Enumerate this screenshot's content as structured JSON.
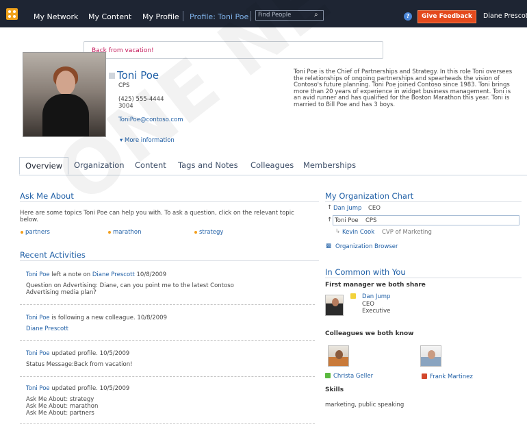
{
  "topbar": {
    "nav": [
      "My Network",
      "My Content",
      "My Profile"
    ],
    "profile_link": "Profile: Toni Poe",
    "search_placeholder": "Find People",
    "help": "?",
    "feedback": "Give Feedback",
    "user": "Diane Prescott"
  },
  "profile": {
    "status": "Back from vacation!",
    "name": "Toni Poe",
    "dept": "CPS",
    "phone": "(425) 555-4444",
    "office": "3004",
    "email": "ToniPoe@contoso.com",
    "more": "More information",
    "bio": "Toni Poe is the Chief of Partnerships and Strategy. In this role Toni oversees the relationships of ongoing partnerships and spearheads the vision of Contoso's future planning. Toni Poe joined Contoso since 1983. Toni brings more than 20 years of experience in widget business management. Toni is an avid runner and has qualified for the Boston Marathon this year. Toni is married to Bill Poe and has 3 boys."
  },
  "tabs": [
    "Overview",
    "Organization",
    "Content",
    "Tags and Notes",
    "Colleagues",
    "Memberships"
  ],
  "ask": {
    "title": "Ask Me About",
    "intro_line1": "Here are some topics Toni Poe can help you with. To ask a question, click on the relevant topic",
    "intro_line2": "below.",
    "topics": [
      "partners",
      "marathon",
      "strategy"
    ]
  },
  "activities": {
    "title": "Recent Activities",
    "items": [
      {
        "actor": "Toni Poe",
        "action": "left a note on",
        "target": "Diane Prescott",
        "date": "10/8/2009",
        "detail1": "Question on Advertising: Diane, can you point me to the latest Contoso",
        "detail2": "Advertising media plan?"
      },
      {
        "actor": "Toni Poe",
        "action": "is following a new colleague.",
        "date": "10/8/2009",
        "link": "Diane Prescott"
      },
      {
        "actor": "Toni Poe",
        "action": "updated profile.",
        "date": "10/5/2009",
        "detail1": "Status Message:Back from vacation!"
      },
      {
        "actor": "Toni Poe",
        "action": "updated profile.",
        "date": "10/5/2009",
        "detail1": "Ask Me About: strategy",
        "detail2": "Ask Me About: marathon",
        "detail3": "Ask Me About: partners"
      }
    ]
  },
  "org": {
    "title": "My Organization Chart",
    "rows": [
      {
        "name": "Dan Jump",
        "title": "CEO"
      },
      {
        "name": "Toni Poe",
        "title": "CPS"
      },
      {
        "name": "Kevin Cook",
        "title": "CVP of Marketing"
      }
    ],
    "browser": "Organization Browser"
  },
  "common": {
    "title": "In Common with You",
    "manager_heading": "First manager we both share",
    "manager": {
      "name": "Dan Jump",
      "title": "CEO",
      "level": "Executive"
    },
    "colleagues_heading": "Colleagues we both know",
    "colleagues": [
      "Christa Geller",
      "Frank Martinez"
    ],
    "skills_heading": "Skills",
    "skills": "marketing, public speaking"
  },
  "watermark": "ONE NETWO"
}
